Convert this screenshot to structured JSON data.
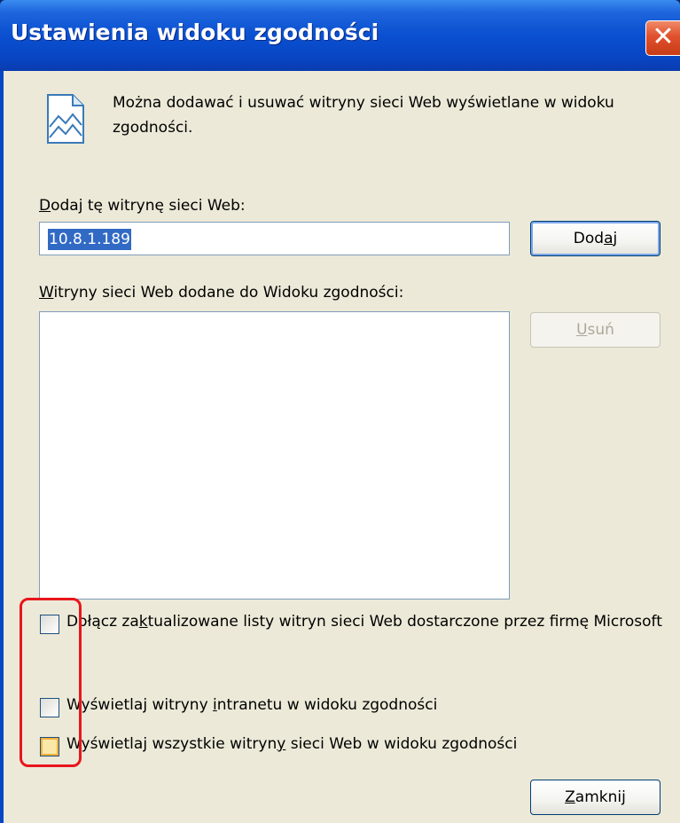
{
  "window": {
    "title": "Ustawienia widoku zgodności",
    "close_symbol": "✕"
  },
  "info": {
    "icon": "web-page-icon",
    "text": "Można dodawać i usuwać witryny sieci Web wyświetlane w widoku zgodności."
  },
  "add_section": {
    "label_prefix": "",
    "label_accel": "D",
    "label_rest": "odaj tę witrynę sieci Web:",
    "input_value": "10.8.1.189",
    "button_prefix": "Dod",
    "button_accel": "a",
    "button_suffix": "j"
  },
  "list_section": {
    "label_accel": "W",
    "label_rest": "itryny sieci Web dodane do Widoku zgodności:",
    "items": [],
    "remove_prefix": "",
    "remove_accel": "U",
    "remove_suffix": "suń"
  },
  "options": [
    {
      "pre": "Dołącz za",
      "accel": "k",
      "post": "tualizowane listy witryn sieci Web dostarczone przez firmę Microsoft",
      "checked": false
    },
    {
      "pre": "Wyświetlaj witryny ",
      "accel": "i",
      "post": "ntranetu w widoku zgodności",
      "checked": false
    },
    {
      "pre": "Wyświetlaj wszystkie witryn",
      "accel": "y",
      "post": " sieci Web w widoku zgodności",
      "checked": false
    }
  ],
  "footer": {
    "close_accel": "Z",
    "close_rest": "amknij"
  },
  "colors": {
    "titlebar": "#0a50d0",
    "dialog_bg": "#ece9d8",
    "highlight": "#e8161c",
    "selection": "#316ac5"
  }
}
